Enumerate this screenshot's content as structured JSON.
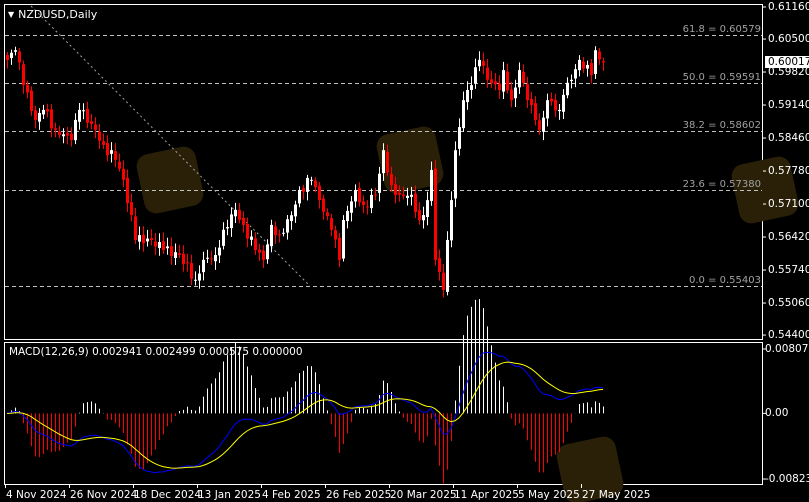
{
  "chart": {
    "symbol_label": "NZDUSD,Daily",
    "current_price": "0.60017",
    "price_axis": [
      "0.61160",
      "0.60500",
      "0.59820",
      "0.59140",
      "0.58460",
      "0.57780",
      "0.57100",
      "0.56420",
      "0.55740",
      "0.55060",
      "0.54400"
    ],
    "price_axis_values": [
      0.6116,
      0.605,
      0.5982,
      0.5914,
      0.5846,
      0.5778,
      0.571,
      0.5642,
      0.5574,
      0.5506,
      0.544
    ],
    "fib_levels": [
      {
        "label": "61.8 = 0.60579",
        "price": 0.60579
      },
      {
        "label": "50.0 = 0.59591",
        "price": 0.59591
      },
      {
        "label": "38.2 = 0.58602",
        "price": 0.58602
      },
      {
        "label": "23.6 = 0.57380",
        "price": 0.5738
      },
      {
        "label": "0.0 = 0.55403",
        "price": 0.55403
      }
    ],
    "date_axis": [
      "4 Nov 2024",
      "26 Nov 2024",
      "18 Dec 2024",
      "13 Jan 2025",
      "4 Feb 2025",
      "26 Feb 2025",
      "20 Mar 2025",
      "11 Apr 2025",
      "5 May 2025",
      "27 May 2025"
    ],
    "bars_between_date_labels": 16,
    "bar_count": 150,
    "close_keypoints": [
      [
        0,
        0.6007
      ],
      [
        2,
        0.6027
      ],
      [
        4,
        0.5955
      ],
      [
        7,
        0.5883
      ],
      [
        9,
        0.5904
      ],
      [
        12,
        0.5863
      ],
      [
        16,
        0.5842
      ],
      [
        18,
        0.5904
      ],
      [
        22,
        0.5863
      ],
      [
        24,
        0.5832
      ],
      [
        27,
        0.5801
      ],
      [
        29,
        0.576
      ],
      [
        32,
        0.5636
      ],
      [
        36,
        0.5636
      ],
      [
        39,
        0.5615
      ],
      [
        43,
        0.5605
      ],
      [
        47,
        0.5554
      ],
      [
        49,
        0.5595
      ],
      [
        52,
        0.5605
      ],
      [
        54,
        0.5657
      ],
      [
        57,
        0.5698
      ],
      [
        59,
        0.5667
      ],
      [
        62,
        0.5615
      ],
      [
        64,
        0.5595
      ],
      [
        66,
        0.5667
      ],
      [
        68,
        0.5646
      ],
      [
        71,
        0.5687
      ],
      [
        73,
        0.5739
      ],
      [
        76,
        0.576
      ],
      [
        78,
        0.5718
      ],
      [
        81,
        0.5657
      ],
      [
        83,
        0.5595
      ],
      [
        84,
        0.5677
      ],
      [
        87,
        0.5739
      ],
      [
        89,
        0.5708
      ],
      [
        92,
        0.5729
      ],
      [
        94,
        0.5821
      ],
      [
        96,
        0.5749
      ],
      [
        98,
        0.5729
      ],
      [
        101,
        0.5729
      ],
      [
        103,
        0.5677
      ],
      [
        105,
        0.5718
      ],
      [
        106,
        0.578
      ],
      [
        107,
        0.5595
      ],
      [
        109,
        0.5533
      ],
      [
        110,
        0.5636
      ],
      [
        112,
        0.5821
      ],
      [
        114,
        0.5924
      ],
      [
        116,
        0.5955
      ],
      [
        118,
        0.6007
      ],
      [
        120,
        0.5966
      ],
      [
        123,
        0.5945
      ],
      [
        124,
        0.5986
      ],
      [
        126,
        0.5924
      ],
      [
        128,
        0.5986
      ],
      [
        130,
        0.5924
      ],
      [
        132,
        0.5883
      ],
      [
        133,
        0.5863
      ],
      [
        135,
        0.5924
      ],
      [
        138,
        0.5904
      ],
      [
        139,
        0.5935
      ],
      [
        141,
        0.5966
      ],
      [
        143,
        0.6007
      ],
      [
        146,
        0.5976
      ],
      [
        147,
        0.6027
      ],
      [
        149,
        0.60017
      ]
    ],
    "colors": {
      "bull": "#ffffff",
      "bear": "#ff0000",
      "grid": "#c0c0c0",
      "macd_line": "#0000ff",
      "signal_line": "#ffff00",
      "hist_pos": "#ffffff",
      "hist_neg": "#ff0000",
      "watermark": "#2a2008"
    }
  },
  "macd": {
    "title": "MACD(12,26,9) 0.002941 0.002499 0.000575 0.000000",
    "axis": [
      "0.008073",
      "0.00",
      "-0.008233"
    ],
    "range": [
      -0.008233,
      0.008073
    ]
  }
}
